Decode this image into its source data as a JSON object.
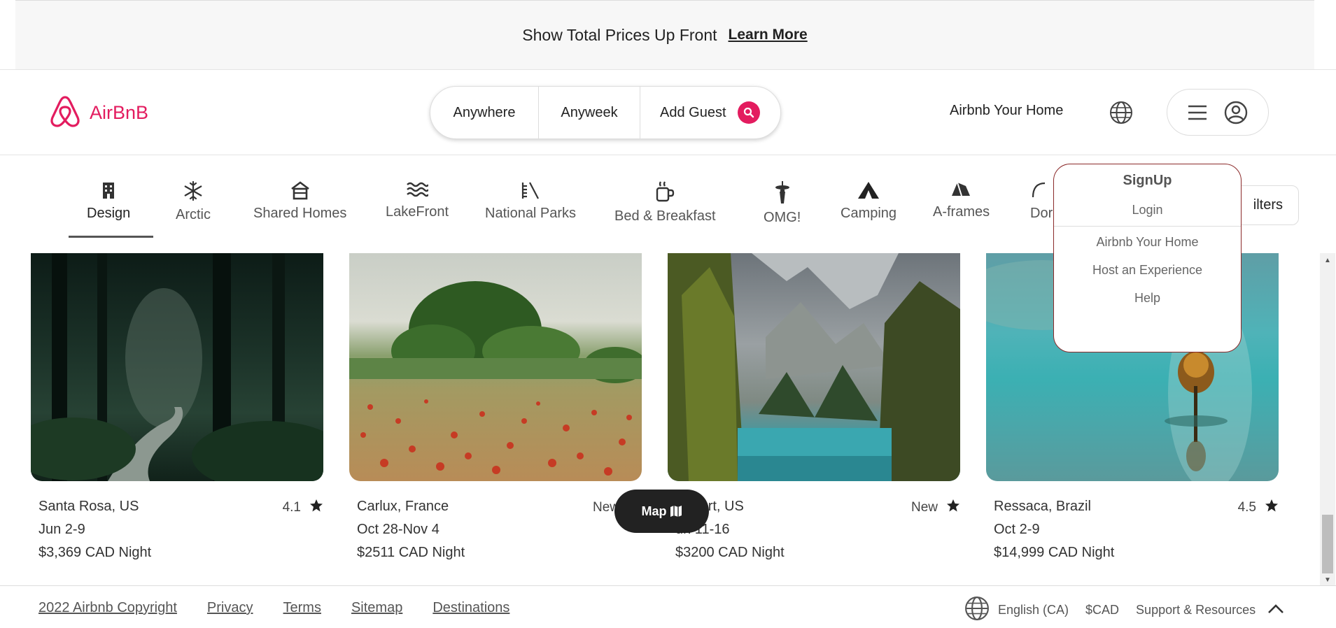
{
  "banner": {
    "message": "Show Total Prices Up Front",
    "link": "Learn More"
  },
  "brand": {
    "name": "AirBnB",
    "color": "#e31c5f"
  },
  "search": {
    "where": "Anywhere",
    "when": "Anyweek",
    "guests": "Add Guest"
  },
  "header": {
    "host_link": "Airbnb Your Home"
  },
  "categories": [
    {
      "label": "Design",
      "icon": "building-icon"
    },
    {
      "label": "Arctic",
      "icon": "snowflake-icon"
    },
    {
      "label": "Shared Homes",
      "icon": "house-icon"
    },
    {
      "label": "LakeFront",
      "icon": "waves-icon"
    },
    {
      "label": "National Parks",
      "icon": "park-icon"
    },
    {
      "label": "Bed & Breakfast",
      "icon": "mug-icon"
    },
    {
      "label": "OMG!",
      "icon": "space-needle-icon"
    },
    {
      "label": "Camping",
      "icon": "tent-icon"
    },
    {
      "label": "A-frames",
      "icon": "a-frame-icon"
    },
    {
      "label": "Dor",
      "icon": "dome-icon"
    }
  ],
  "filters": {
    "label": "ilters"
  },
  "listings": [
    {
      "location": "Santa Rosa, US",
      "dates": "Jun 2-9",
      "price": "$3,369 CAD Night",
      "rating": "4.1"
    },
    {
      "location": "Carlux, France",
      "dates": "Oct 28-Nov 4",
      "price": "$2511 CAD Night",
      "rating": "New"
    },
    {
      "location": "Desert, US",
      "dates": "un 11-16",
      "price": "$3200 CAD Night",
      "rating": "New"
    },
    {
      "location": "Ressaca, Brazil",
      "dates": "Oct 2-9",
      "price": "$14,999 CAD Night",
      "rating": "4.5"
    }
  ],
  "map_button": {
    "label": "Map"
  },
  "user_menu": {
    "signup": "SignUp",
    "login": "Login",
    "items": [
      "Airbnb Your Home",
      "Host an Experience",
      "Help"
    ]
  },
  "footer": {
    "links": [
      "2022 Airbnb Copyright",
      "Privacy",
      "Terms",
      "Sitemap",
      "Destinations"
    ],
    "language": "English (CA)",
    "currency": "$CAD",
    "support": "Support & Resources"
  }
}
